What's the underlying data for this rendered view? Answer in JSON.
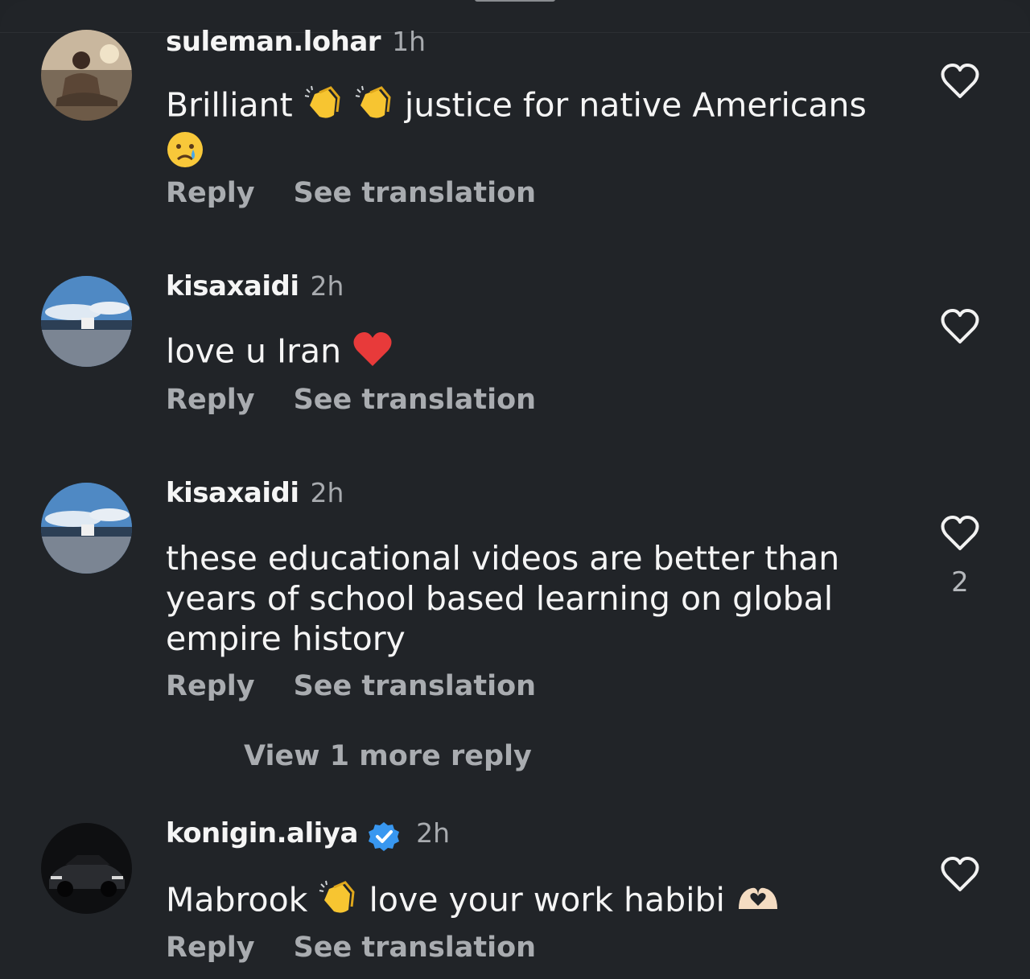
{
  "comments": [
    {
      "username": "suleman.lohar",
      "time": "1h",
      "text_parts": [
        "Brilliant",
        "justice for native Americans"
      ],
      "reply_label": "Reply",
      "translate_label": "See translation",
      "avatar": "man-sitting-photo"
    },
    {
      "username": "kisaxaidi",
      "time": "2h",
      "text_parts": [
        "love u Iran"
      ],
      "reply_label": "Reply",
      "translate_label": "See translation",
      "avatar": "sky-landscape-photo"
    },
    {
      "username": "kisaxaidi",
      "time": "2h",
      "text": "these educational videos are better than years of school based learning on global empire history",
      "reply_label": "Reply",
      "translate_label": "See translation",
      "like_count": "2",
      "view_more": "View 1 more reply",
      "avatar": "sky-landscape-photo"
    },
    {
      "username": "konigin.aliya",
      "verified": true,
      "time": "2h",
      "text_parts": [
        "Mabrook",
        "love your work habibi"
      ],
      "reply_label": "Reply",
      "translate_label": "See translation",
      "avatar": "dark-car-photo"
    }
  ],
  "icons": {
    "like": "heart-outline-icon",
    "verified": "verified-badge-icon",
    "clap": "clapping-hands-emoji",
    "cry": "crying-face-emoji",
    "heart": "red-heart-emoji",
    "heart_hands": "heart-hands-emoji"
  },
  "colors": {
    "background": "#212428",
    "primary_text": "#f5f5f5",
    "secondary_text": "#a9acb0",
    "verified": "#3897f0"
  }
}
